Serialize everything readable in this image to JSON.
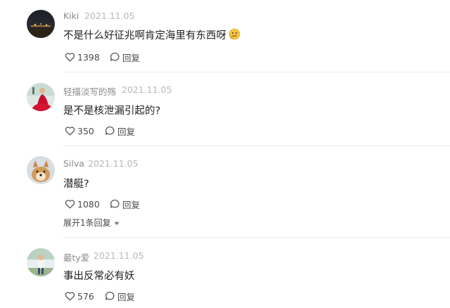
{
  "comments": [
    {
      "username": "Kiki",
      "date": "2021.11.05",
      "text": "不是什么好征兆啊肯定海里有东西呀",
      "emoji": "thinking-face-emoji",
      "likes": "1398",
      "reply_label": "回复"
    },
    {
      "username": "轻描淡写的殇",
      "date": "2021.11.05",
      "text": "是不是核泄漏引起的?",
      "likes": "350",
      "reply_label": "回复"
    },
    {
      "username": "Silva",
      "date": "2021.11.05",
      "text": "潜艇?",
      "likes": "1080",
      "reply_label": "回复",
      "expand_replies_label": "展开1条回复"
    },
    {
      "username": "最ty爱",
      "date": "2021.11.05",
      "text": "事出反常必有妖",
      "likes": "576",
      "reply_label": "回复"
    }
  ],
  "icons": {
    "like": "heart-outline-icon",
    "reply": "speech-bubble-icon",
    "expand": "caret-down-icon"
  },
  "colors": {
    "username": "#8a8a8a",
    "date": "#b8b8b8",
    "text": "#1f1f1f",
    "action": "#4a4a4a"
  }
}
